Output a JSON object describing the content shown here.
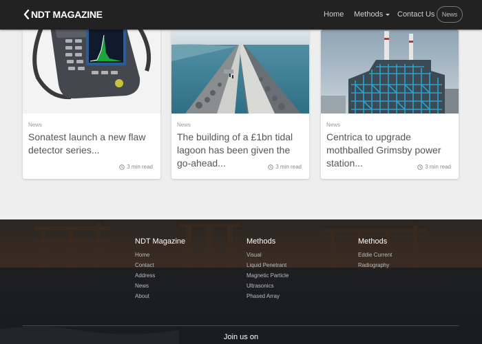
{
  "navbar": {
    "brand": "NDT MAGAZINE",
    "links": {
      "home": "Home",
      "methods": "Methods",
      "contact": "Contact Us",
      "news": "News"
    }
  },
  "cards": [
    {
      "category": "News",
      "title": "Sonatest launch a new flaw detector series...",
      "read_time": "3 min read"
    },
    {
      "category": "News",
      "title": "The building of a £1bn tidal lagoon has been given the go-ahead...",
      "read_time": "3 min read"
    },
    {
      "category": "News",
      "title": "Centrica to upgrade mothballed Grimsby power station...",
      "read_time": "3 min read"
    }
  ],
  "footer": {
    "columns": [
      {
        "heading": "NDT Magazine",
        "items": [
          "Home",
          "Contact",
          "Address",
          "News",
          "About"
        ]
      },
      {
        "heading": "Methods",
        "items": [
          "Visual",
          "Liquid Penetrant",
          "Magnetic Particle",
          "Ultrasonics",
          "Phased Array"
        ]
      },
      {
        "heading": "Methods",
        "items": [
          "Eddie Current",
          "Radiography"
        ]
      }
    ],
    "join_us": "Join us on"
  }
}
